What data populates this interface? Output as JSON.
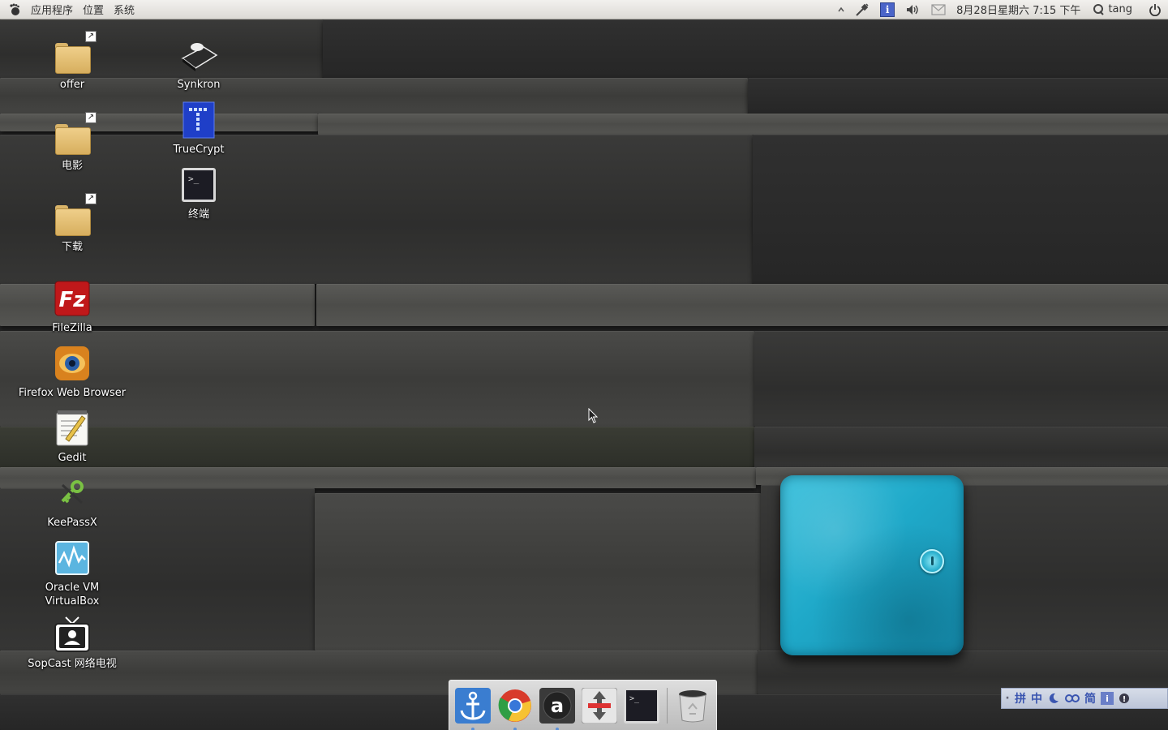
{
  "panel": {
    "menus": [
      "应用程序",
      "位置",
      "系统"
    ],
    "clock": "8月28日星期六 7:15 下午",
    "user": "tang"
  },
  "desktop": {
    "icons": [
      {
        "label": "offer",
        "icon": "folder-link-icon"
      },
      {
        "label": "电影",
        "icon": "folder-link-icon"
      },
      {
        "label": "下载",
        "icon": "folder-link-icon"
      },
      {
        "label": "FileZilla",
        "icon": "filezilla-icon"
      },
      {
        "label": "Firefox Web Browser",
        "icon": "firefox-icon"
      },
      {
        "label": "Gedit",
        "icon": "gedit-icon"
      },
      {
        "label": "KeePassX",
        "icon": "keepassx-icon"
      },
      {
        "label": "Oracle VM\nVirtualBox",
        "icon": "virtualbox-icon"
      },
      {
        "label": "SopCast 网络电视",
        "icon": "sopcast-icon"
      },
      {
        "label": "Synkron",
        "icon": "synkron-icon"
      },
      {
        "label": "TrueCrypt",
        "icon": "truecrypt-icon"
      },
      {
        "label": "终端",
        "icon": "terminal-icon"
      }
    ]
  },
  "dock": {
    "items": [
      "anchor-icon",
      "chrome-icon",
      "a-icon",
      "arrows-icon",
      "terminal-icon",
      "trash-icon"
    ]
  },
  "ime": {
    "items": [
      "拼",
      "中",
      "简"
    ]
  },
  "colors": {
    "panel_bg": "#e6e4df",
    "ime_blue": "#3a55b0",
    "box_cyan": "#1fa9c9"
  }
}
